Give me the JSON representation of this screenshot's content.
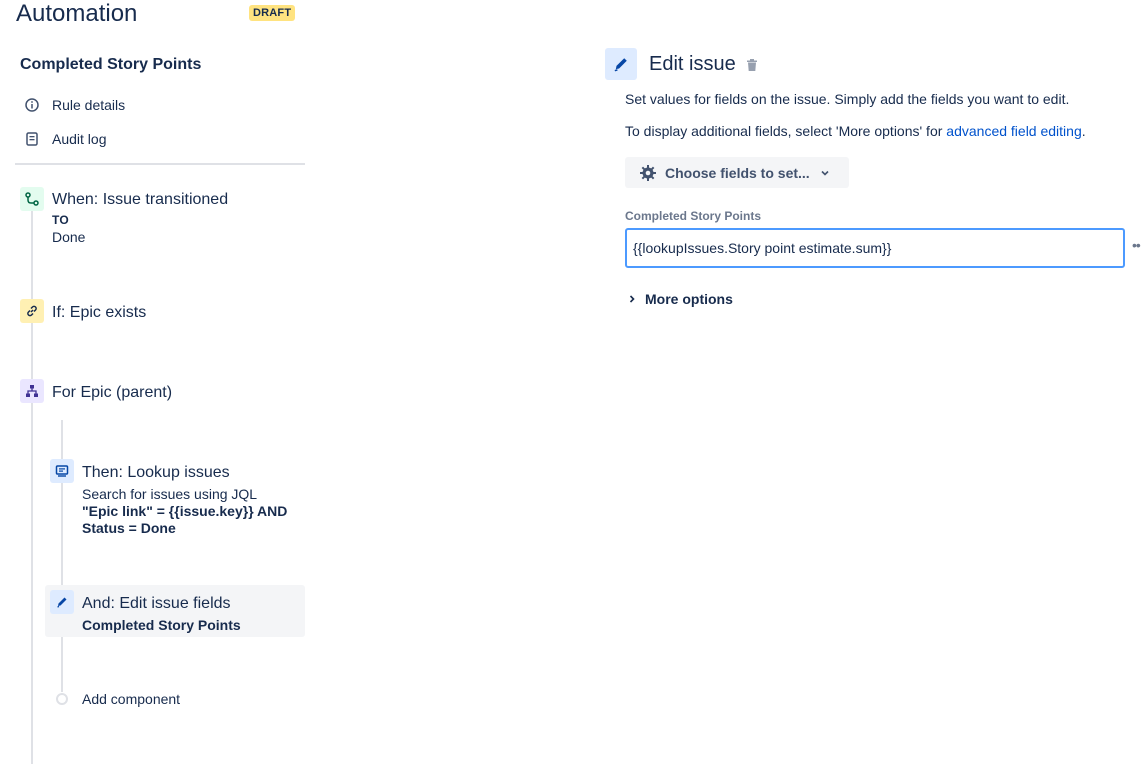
{
  "header": {
    "title": "Automation",
    "badge": "DRAFT"
  },
  "sidebar": {
    "rule_name": "Completed Story Points",
    "links": [
      {
        "label": "Rule details",
        "icon": "info-icon"
      },
      {
        "label": "Audit log",
        "icon": "document-icon"
      }
    ]
  },
  "steps": {
    "trigger": {
      "title": "When: Issue transitioned",
      "to_label": "TO",
      "to_value": "Done",
      "icon": "transition-icon",
      "color": "#e3fcef"
    },
    "condition": {
      "title": "If: Epic exists",
      "icon": "link-icon",
      "color": "#fff0b3"
    },
    "branch": {
      "title": "For Epic (parent)",
      "icon": "hierarchy-icon",
      "color": "#eae6ff"
    },
    "lookup": {
      "title": "Then: Lookup issues",
      "sub": "Search for issues using JQL",
      "jql": "\"Epic link\" = {{issue.key}} AND Status = Done",
      "icon": "monitor-icon",
      "color": "#deebff"
    },
    "edit": {
      "title": "And: Edit issue fields",
      "sub": "Completed Story Points",
      "icon": "pencil-icon",
      "color": "#deebff"
    },
    "add": {
      "label": "Add component"
    }
  },
  "panel": {
    "title": "Edit issue",
    "desc1": "Set values for fields on the issue. Simply add the fields you want to edit.",
    "desc2_prefix": "To display additional fields, select 'More options' for ",
    "desc2_link": "advanced field editing",
    "desc2_suffix": ".",
    "choose_button": "Choose fields to set...",
    "field_label": "Completed Story Points",
    "field_value": "{{lookupIssues.Story point estimate.sum}}",
    "more_options": "More options"
  },
  "colors": {
    "accent": "#0052cc",
    "focus": "#4c9aff",
    "badge": "#ffe380"
  }
}
